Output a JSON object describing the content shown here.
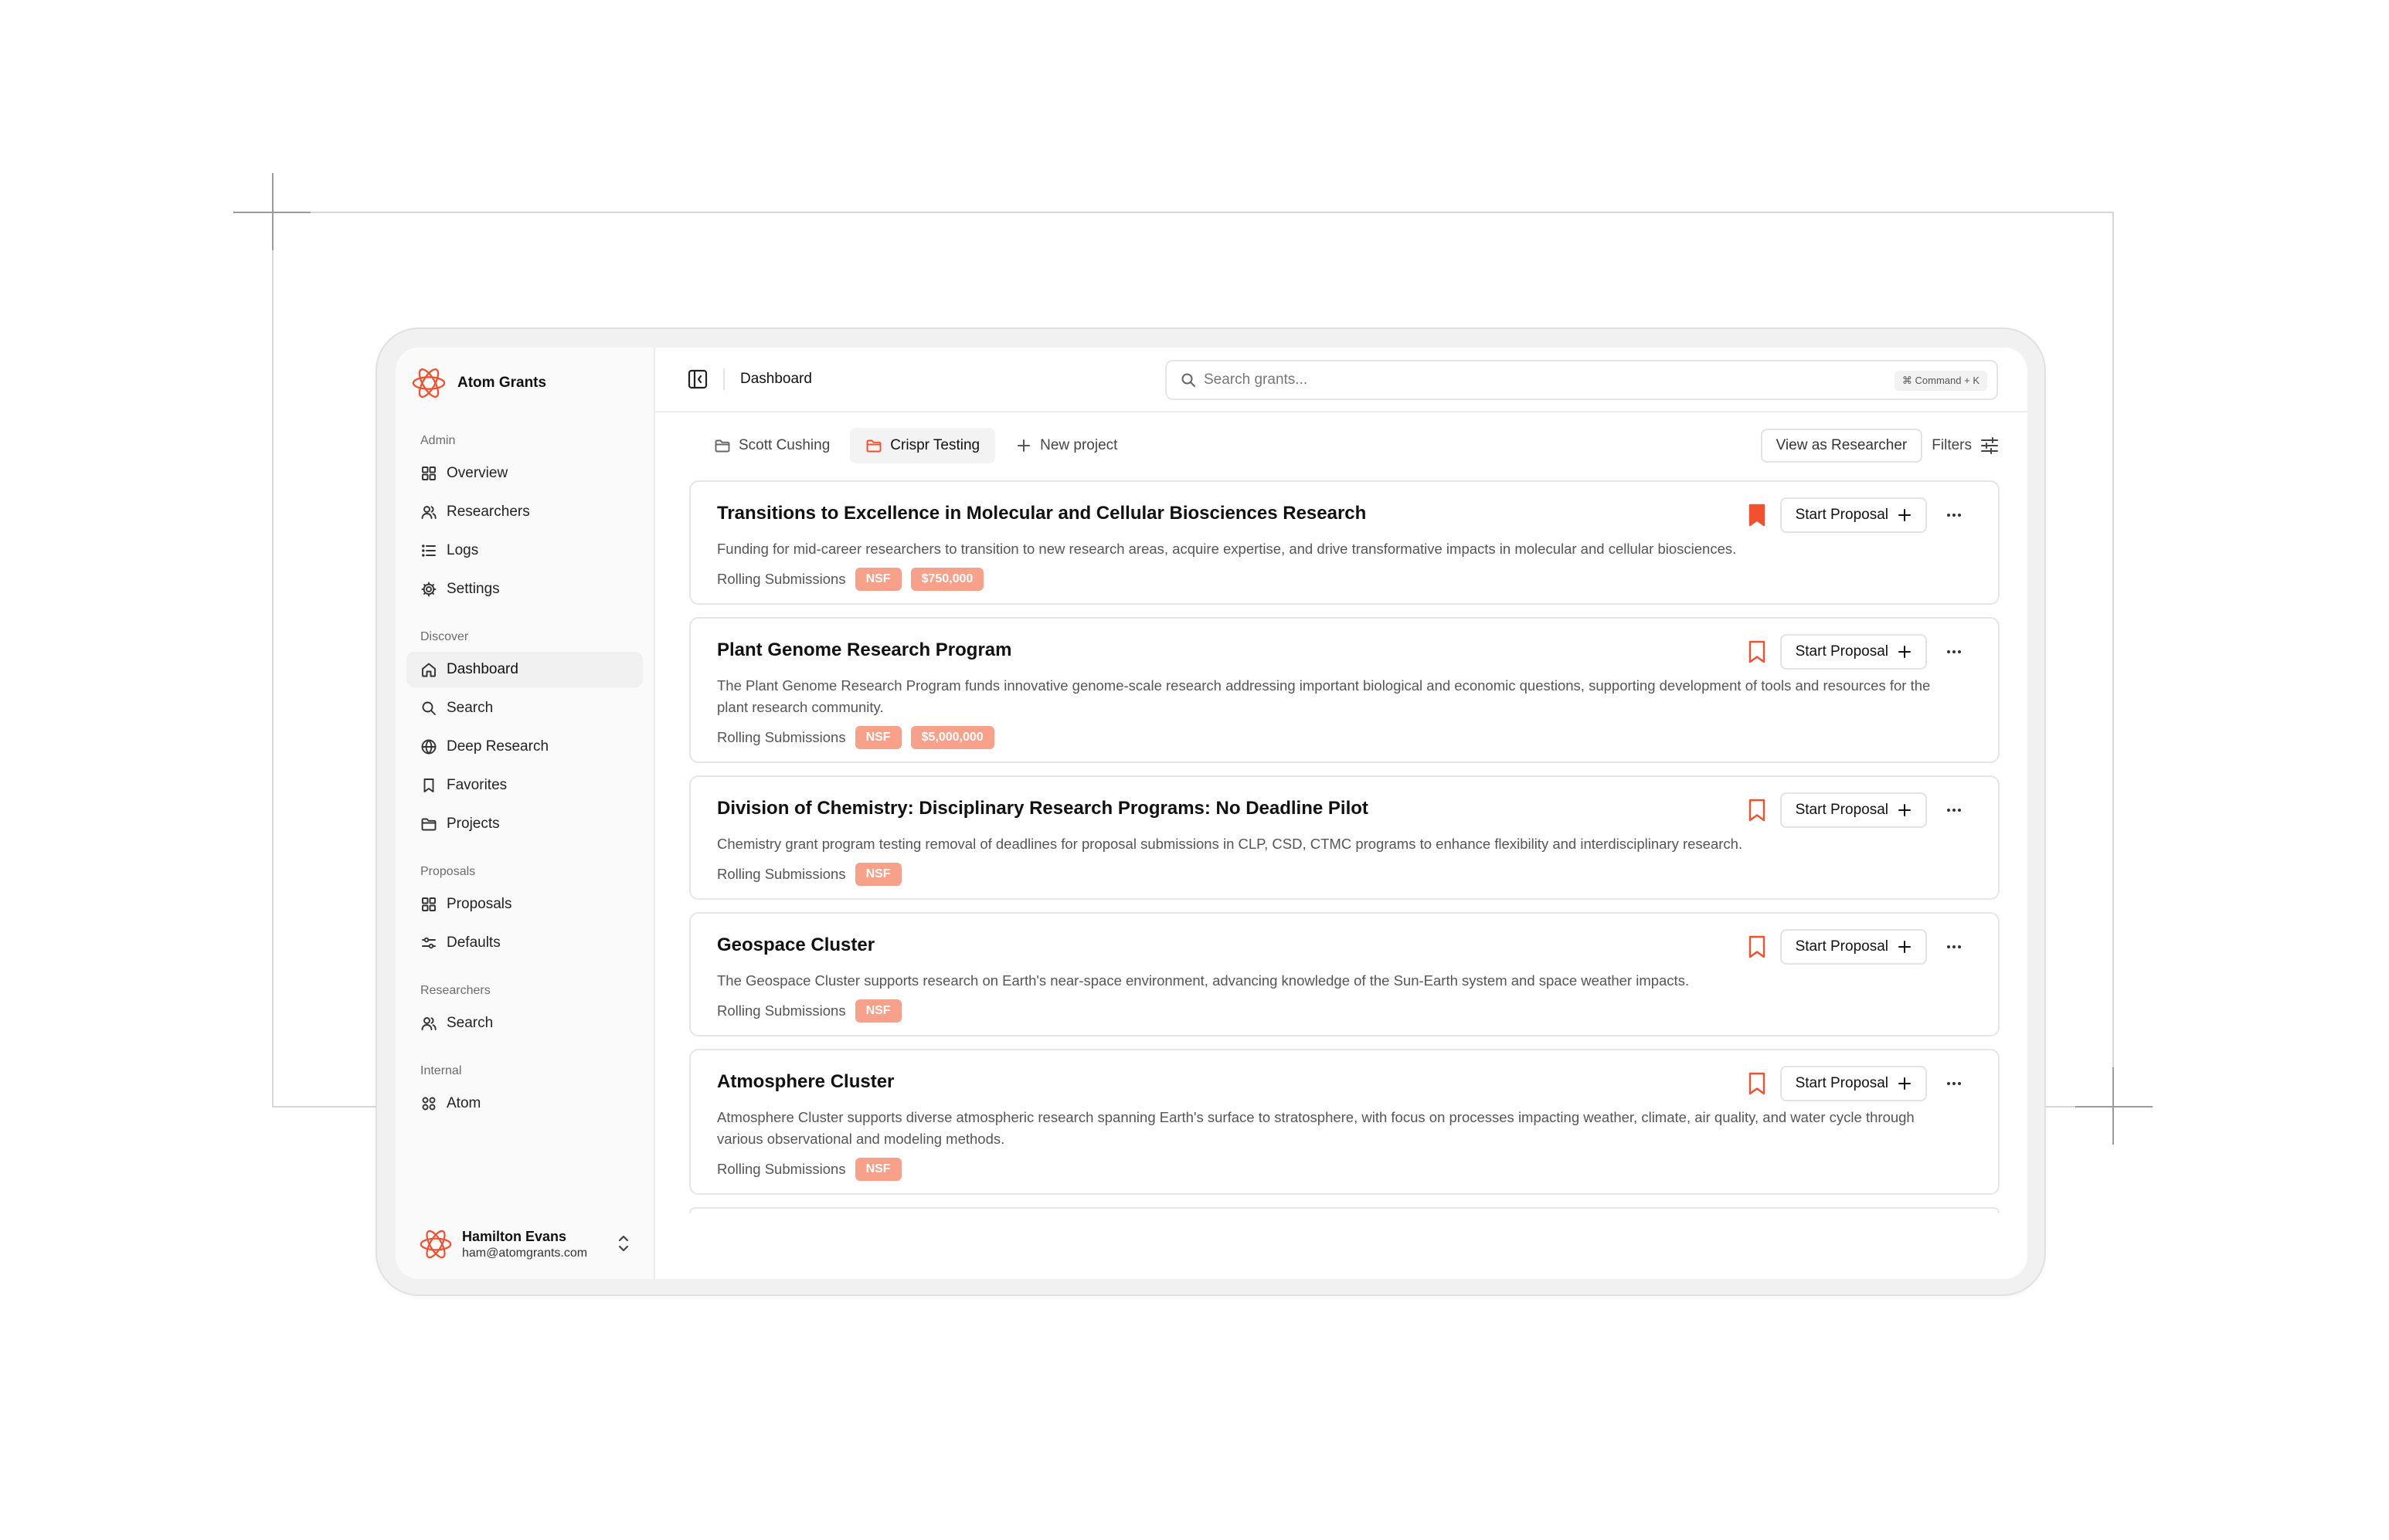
{
  "app": {
    "name": "Atom Grants"
  },
  "sidebar": {
    "sections": [
      {
        "label": "Admin",
        "items": [
          {
            "label": "Overview",
            "icon": "grid-icon"
          },
          {
            "label": "Researchers",
            "icon": "users-icon"
          },
          {
            "label": "Logs",
            "icon": "list-icon"
          },
          {
            "label": "Settings",
            "icon": "gear-icon"
          }
        ]
      },
      {
        "label": "Discover",
        "items": [
          {
            "label": "Dashboard",
            "icon": "home-icon",
            "active": true
          },
          {
            "label": "Search",
            "icon": "search-icon"
          },
          {
            "label": "Deep Research",
            "icon": "globe-icon"
          },
          {
            "label": "Favorites",
            "icon": "bookmark-icon"
          },
          {
            "label": "Projects",
            "icon": "folder-icon"
          }
        ]
      },
      {
        "label": "Proposals",
        "items": [
          {
            "label": "Proposals",
            "icon": "grid-icon"
          },
          {
            "label": "Defaults",
            "icon": "sliders-icon"
          }
        ]
      },
      {
        "label": "Researchers",
        "items": [
          {
            "label": "Search",
            "icon": "users-icon"
          }
        ]
      },
      {
        "label": "Internal",
        "items": [
          {
            "label": "Atom",
            "icon": "atom-grid-icon"
          }
        ]
      }
    ],
    "user": {
      "name": "Hamilton Evans",
      "email": "ham@atomgrants.com"
    }
  },
  "header": {
    "breadcrumb": "Dashboard",
    "search_placeholder": "Search grants...",
    "search_shortcut": "⌘ Command + K"
  },
  "tabs": {
    "items": [
      {
        "label": "Scott Cushing",
        "active": false
      },
      {
        "label": "Crispr Testing",
        "active": true
      }
    ],
    "new_project": "New project",
    "view_as": "View as Researcher",
    "filters": "Filters"
  },
  "grants": [
    {
      "title": "Transitions to Excellence in Molecular and Cellular Biosciences Research",
      "description": "Funding for mid-career researchers to transition to new research areas, acquire expertise, and drive transformative impacts in molecular and cellular biosciences.",
      "submission": "Rolling Submissions",
      "badges": [
        "NSF",
        "$750,000"
      ],
      "bookmarked": true
    },
    {
      "title": "Plant Genome Research Program",
      "description": "The Plant Genome Research Program funds innovative genome-scale research addressing important biological and economic questions, supporting development of tools and resources for the plant research community.",
      "submission": "Rolling Submissions",
      "badges": [
        "NSF",
        "$5,000,000"
      ],
      "bookmarked": false
    },
    {
      "title": "Division of Chemistry: Disciplinary Research Programs: No Deadline Pilot",
      "description": "Chemistry grant program testing removal of deadlines for proposal submissions in CLP, CSD, CTMC programs to enhance flexibility and interdisciplinary research.",
      "submission": "Rolling Submissions",
      "badges": [
        "NSF"
      ],
      "bookmarked": false
    },
    {
      "title": "Geospace Cluster",
      "description": "The Geospace Cluster supports research on Earth's near-space environment, advancing knowledge of the Sun-Earth system and space weather impacts.",
      "submission": "Rolling Submissions",
      "badges": [
        "NSF"
      ],
      "bookmarked": false
    },
    {
      "title": "Atmosphere Cluster",
      "description": "Atmosphere Cluster supports diverse atmospheric research spanning Earth's surface to stratosphere, with focus on processes impacting weather, climate, air quality, and water cycle through various observational and modeling methods.",
      "submission": "Rolling Submissions",
      "badges": [
        "NSF"
      ],
      "bookmarked": false
    }
  ],
  "card_action_label": "Start Proposal",
  "colors": {
    "accent": "#f2502e",
    "badge": "#f7a08a",
    "background": "#fafafa"
  }
}
